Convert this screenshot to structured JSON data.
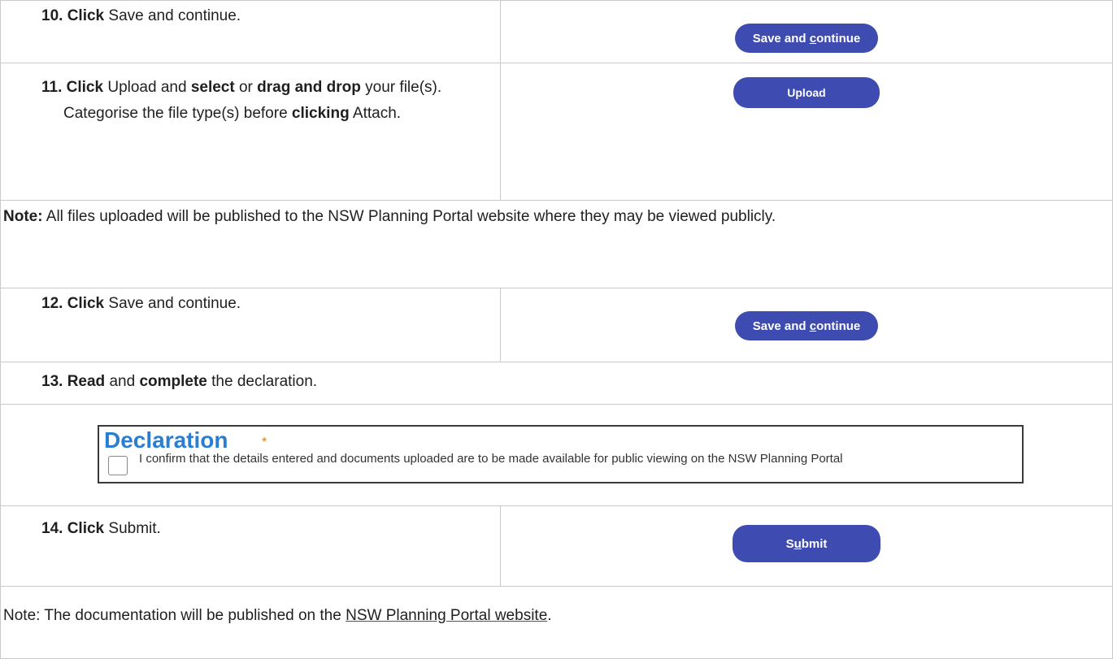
{
  "steps": {
    "s10": {
      "num": "10.",
      "kw1": "Click",
      "text": " Save and continue."
    },
    "s11": {
      "num": "11.",
      "kw1": "Click",
      "t1": " Upload and ",
      "kw2": "select",
      "t2": " or ",
      "kw3": "drag and drop",
      "t3": " your file(s). Categorise the file type(s) before ",
      "kw4": "clicking",
      "t4": " Attach."
    },
    "s12": {
      "num": "12.",
      "kw1": "Click",
      "text": " Save and continue."
    },
    "s13": {
      "num": "13.",
      "kw1": "Read",
      "t1": " and ",
      "kw2": "complete",
      "t2": " the declaration."
    },
    "s14": {
      "num": "14.",
      "kw1": "Click",
      "text": " Submit."
    }
  },
  "buttons": {
    "save_pre": "Save and ",
    "save_acc": "c",
    "save_post": "ontinue",
    "upload": "Upload",
    "submit_pre": "S",
    "submit_acc": "u",
    "submit_post": "bmit"
  },
  "note1": {
    "label": "Note:",
    "text": " All files uploaded will be published to the NSW Planning Portal website where they may be viewed publicly."
  },
  "declaration": {
    "title": "Declaration",
    "required_mark": "*",
    "text": "I confirm that the details entered and documents uploaded are to be made available for public viewing on the NSW Planning Portal",
    "checked": false
  },
  "note2": {
    "pre": "Note: The documentation will be published on the ",
    "link": "NSW Planning Portal website",
    "post": "."
  },
  "colors": {
    "button": "#3e4bb1",
    "declaration_title": "#2a7ed2",
    "required_mark": "#d9811b",
    "border": "#c9c9c9"
  }
}
